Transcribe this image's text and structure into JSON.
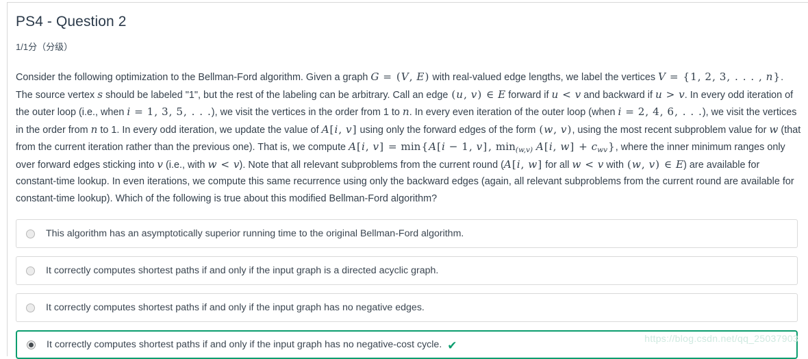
{
  "header": {
    "title": "PS4 - Question 2",
    "points": "1/1分（分级）"
  },
  "question": {
    "segments": [
      {
        "t": "text",
        "v": "Consider the following optimization to the Bellman-Ford algorithm. Given a graph "
      },
      {
        "t": "math",
        "v": "G = (V, E)"
      },
      {
        "t": "text",
        "v": " with real-valued edge lengths, we label the vertices "
      },
      {
        "t": "math",
        "v": "V = {1, 2, 3, . . . , n}"
      },
      {
        "t": "text",
        "v": ". The source vertex "
      },
      {
        "t": "math",
        "v": "s"
      },
      {
        "t": "text",
        "v": " should be labeled \"1\", but the rest of the labeling can be arbitrary. Call an edge "
      },
      {
        "t": "math",
        "v": "(u, v) ∈ E"
      },
      {
        "t": "text",
        "v": " forward if "
      },
      {
        "t": "math",
        "v": "u < v"
      },
      {
        "t": "text",
        "v": " and backward if "
      },
      {
        "t": "math",
        "v": "u > v"
      },
      {
        "t": "text",
        "v": ". In every odd iteration of the outer loop (i.e., when "
      },
      {
        "t": "math",
        "v": "i = 1, 3, 5, . . ."
      },
      {
        "t": "text",
        "v": "), we visit the vertices in the order from 1 to "
      },
      {
        "t": "math",
        "v": "n"
      },
      {
        "t": "text",
        "v": ". In every even iteration of the outer loop (when "
      },
      {
        "t": "math",
        "v": "i = 2, 4, 6, . . ."
      },
      {
        "t": "text",
        "v": "), we visit the vertices in the order from "
      },
      {
        "t": "math",
        "v": "n"
      },
      {
        "t": "text",
        "v": " to 1. In every odd iteration, we update the value of "
      },
      {
        "t": "math",
        "v": "A[i, v]"
      },
      {
        "t": "text",
        "v": " using only the forward edges of the form "
      },
      {
        "t": "math",
        "v": "(w, v)"
      },
      {
        "t": "text",
        "v": ", using the most recent subproblem value for "
      },
      {
        "t": "math",
        "v": "w"
      },
      {
        "t": "text",
        "v": " (that from the current iteration rather than the previous one). That is, we compute "
      },
      {
        "t": "math",
        "v": "A[i, v] = min{A[i − 1, v], min(w,v) A[i, w] + cwv}"
      },
      {
        "t": "text",
        "v": ", where the inner minimum ranges only over forward edges sticking into "
      },
      {
        "t": "math",
        "v": "v"
      },
      {
        "t": "text",
        "v": " (i.e., with "
      },
      {
        "t": "math",
        "v": "w < v"
      },
      {
        "t": "text",
        "v": "). Note that all relevant subproblems from the current round ("
      },
      {
        "t": "math",
        "v": "A[i, w]"
      },
      {
        "t": "text",
        "v": " for all "
      },
      {
        "t": "math",
        "v": "w < v"
      },
      {
        "t": "text",
        "v": " with "
      },
      {
        "t": "math",
        "v": "(w, v) ∈ E"
      },
      {
        "t": "text",
        "v": ") are available for constant-time lookup. In even iterations, we compute this same recurrence using only the backward edges (again, all relevant subproblems from the current round are available for constant-time lookup). Which of the following is true about this modified Bellman-Ford algorithm?"
      }
    ],
    "plain": "Consider the following optimization to the Bellman-Ford algorithm. Given a graph G = (V, E) with real-valued edge lengths, we label the vertices V = {1, 2, 3, . . . , n}. The source vertex s should be labeled \"1\", but the rest of the labeling can be arbitrary. Call an edge (u, v) ∈ E forward if u < v and backward if u > v. In every odd iteration of the outer loop (i.e., when i = 1, 3, 5, . . .), we visit the vertices in the order from 1 to n. In every even iteration of the outer loop (when i = 2, 4, 6, . . .), we visit the vertices in the order from n to 1. In every odd iteration, we update the value of A[i, v] using only the forward edges of the form (w, v), using the most recent subproblem value for w (that from the current iteration rather than the previous one). That is, we compute A[i, v] = min{A[i − 1, v], min(w,v) A[i, w] + cwv}, where the inner minimum ranges only over forward edges sticking into v (i.e., with w < v). Note that all relevant subproblems from the current round (A[i, w] for all w < v with (w, v) ∈ E) are available for constant-time lookup. In even iterations, we compute this same recurrence using only the backward edges (again, all relevant subproblems from the current round are available for constant-time lookup). Which of the following is true about this modified Bellman-Ford algorithm?"
  },
  "options": [
    {
      "label": "This algorithm has an asymptotically superior running time to the original Bellman-Ford algorithm.",
      "selected": false,
      "correct": false
    },
    {
      "label": "It correctly computes shortest paths if and only if the input graph is a directed acyclic graph.",
      "selected": false,
      "correct": false
    },
    {
      "label": "It correctly computes shortest paths if and only if the input graph has no negative edges.",
      "selected": false,
      "correct": false
    },
    {
      "label": "It correctly computes shortest paths if and only if the input graph has no negative-cost cycle.",
      "selected": true,
      "correct": true,
      "check_mark": "✔"
    }
  ],
  "colors": {
    "accent_green": "#0a9d6e",
    "border_gray": "#d9d9d9",
    "text": "#34404c"
  },
  "watermark": {
    "text": "https://blog.csdn.net/qq_25037903"
  }
}
